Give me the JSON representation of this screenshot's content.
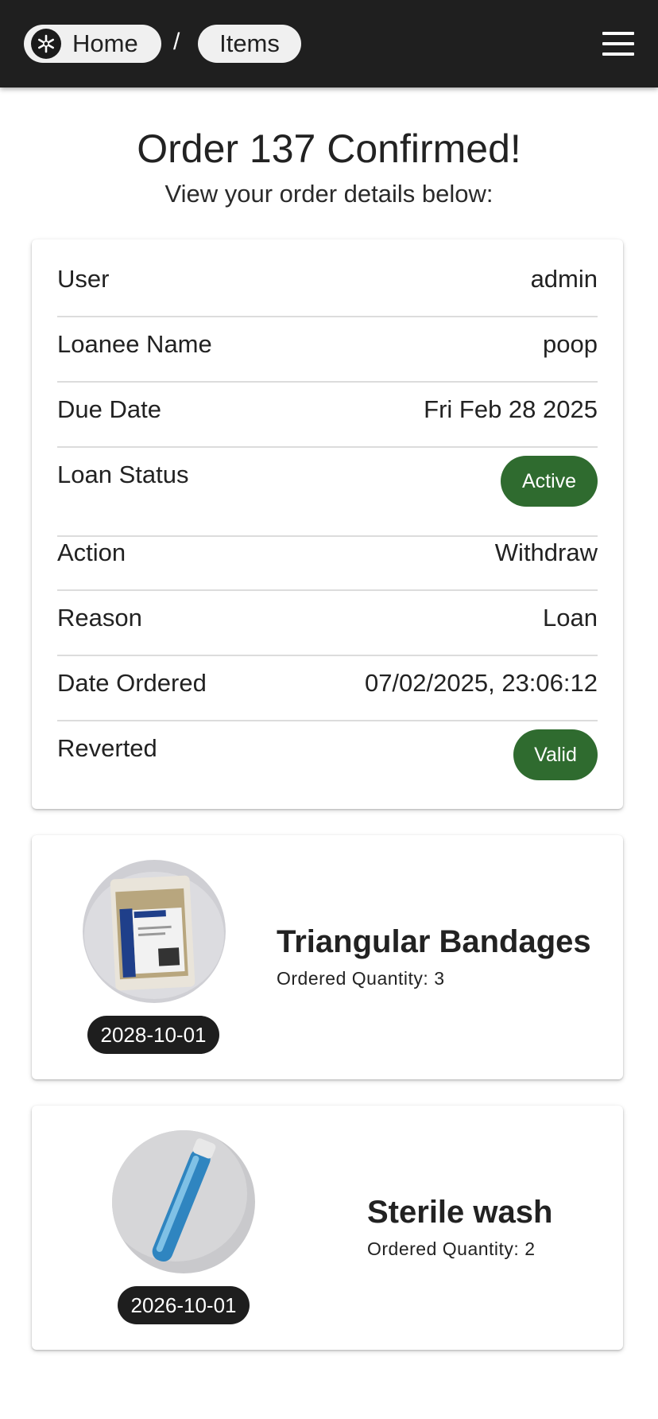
{
  "nav": {
    "home_label": "Home",
    "separator": "/",
    "items_label": "Items"
  },
  "header": {
    "title": "Order 137 Confirmed!",
    "subtitle": "View your order details below:"
  },
  "order": {
    "rows": [
      {
        "label": "User",
        "value": "admin"
      },
      {
        "label": "Loanee Name",
        "value": "poop"
      },
      {
        "label": "Due Date",
        "value": "Fri Feb 28 2025"
      },
      {
        "label": "Loan Status",
        "value": "Active"
      },
      {
        "label": "Action",
        "value": "Withdraw"
      },
      {
        "label": "Reason",
        "value": "Loan"
      },
      {
        "label": "Date Ordered",
        "value": "07/02/2025, 23:06:12"
      },
      {
        "label": "Reverted",
        "value": "Valid"
      }
    ]
  },
  "items": [
    {
      "name": "Triangular Bandages",
      "quantity_text": "Ordered Quantity: 3",
      "expiry": "2028-10-01"
    },
    {
      "name": "Sterile wash",
      "quantity_text": "Ordered Quantity: 2",
      "expiry": "2026-10-01"
    }
  ],
  "colors": {
    "topbar": "#1f1f1f",
    "status_pill": "#2f6b2f",
    "date_badge": "#1e1e1e"
  }
}
